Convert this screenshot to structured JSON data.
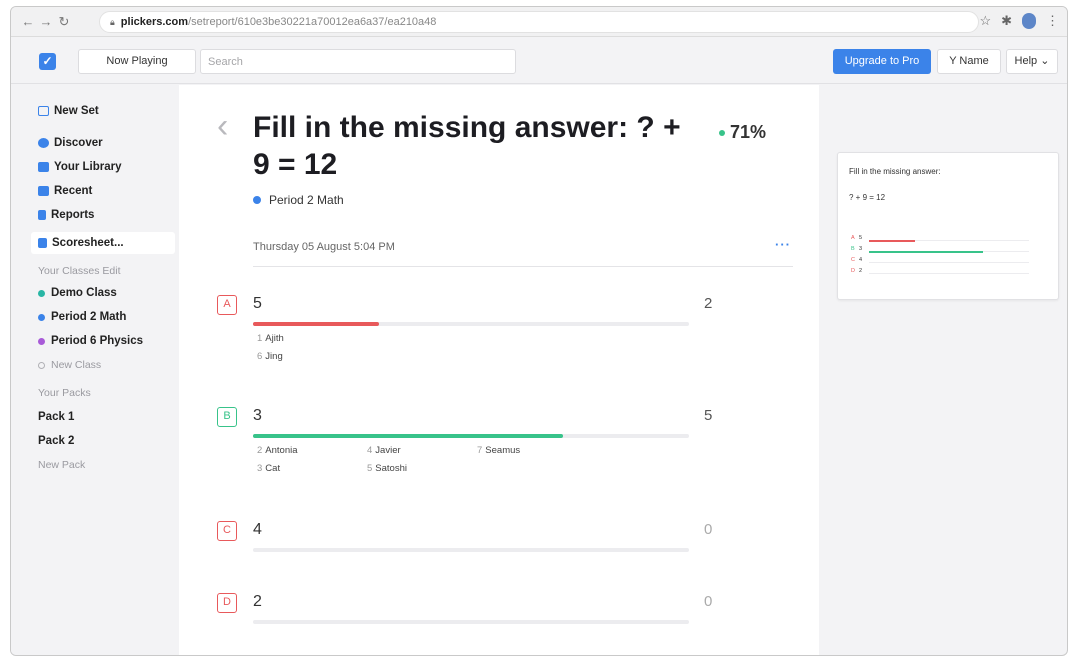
{
  "browser": {
    "url_host": "plickers.com",
    "url_path": "/setreport/610e3be30221a70012ea6a37/ea210a48"
  },
  "topbar": {
    "now_playing": "Now Playing",
    "search_placeholder": "Search",
    "upgrade": "Upgrade to Pro",
    "user": "Y Name",
    "help": "Help ⌄"
  },
  "sidebar": {
    "primary": [
      {
        "label": "New Set",
        "icon": "new-set-icon",
        "color": "#3b83e9"
      },
      {
        "label": "Discover",
        "icon": "discover-icon",
        "color": "#3b83e9"
      },
      {
        "label": "Your Library",
        "icon": "folder-icon",
        "color": "#3b83e9"
      },
      {
        "label": "Recent",
        "icon": "recent-icon",
        "color": "#3b83e9"
      },
      {
        "label": "Reports",
        "icon": "reports-icon",
        "color": "#3b83e9"
      },
      {
        "label": "Scoresheet...",
        "icon": "scoresheet-icon",
        "color": "#3b83e9"
      }
    ],
    "classes_header": "Your Classes  Edit",
    "classes": [
      {
        "label": "Demo Class",
        "color": "#29b6a5"
      },
      {
        "label": "Period 2 Math",
        "color": "#3b83e9"
      },
      {
        "label": "Period 6 Physics",
        "color": "#a85ad8"
      }
    ],
    "new_class": "New Class",
    "packs_header": "Your Packs",
    "packs": [
      "Pack 1",
      "Pack 2"
    ],
    "new_pack": "New Pack"
  },
  "main": {
    "back": "‹",
    "title": "Fill in the missing answer: ? + 9 = 12",
    "percent": "71%",
    "class_name": "Period 2 Math",
    "class_color": "#3b83e9",
    "date": "Thursday 05 August 5:04 PM",
    "more": "···",
    "answers": [
      {
        "letter": "A",
        "value": "5",
        "count": "2",
        "fraction": 0.29,
        "color": "#e8595b",
        "students": [
          {
            "num": "1",
            "name": "Ajith"
          },
          {
            "num": "6",
            "name": "Jing"
          }
        ]
      },
      {
        "letter": "B",
        "value": "3",
        "count": "5",
        "fraction": 0.71,
        "color": "#38c38a",
        "students": [
          {
            "num": "2",
            "name": "Antonia"
          },
          {
            "num": "3",
            "name": "Cat"
          },
          {
            "num": "4",
            "name": "Javier"
          },
          {
            "num": "5",
            "name": "Satoshi"
          },
          {
            "num": "7",
            "name": "Seamus"
          }
        ]
      },
      {
        "letter": "C",
        "value": "4",
        "count": "0",
        "fraction": 0,
        "color": "#e8595b",
        "students": []
      },
      {
        "letter": "D",
        "value": "2",
        "count": "0",
        "fraction": 0,
        "color": "#e8595b",
        "students": []
      }
    ]
  },
  "preview": {
    "question": "Fill in the missing answer:",
    "equation": "? + 9 = 12",
    "rows": [
      {
        "letter": "A",
        "value": "5",
        "color": "#e8595b",
        "fraction": 0.29
      },
      {
        "letter": "B",
        "value": "3",
        "color": "#38c38a",
        "fraction": 0.71
      },
      {
        "letter": "C",
        "value": "4",
        "color": "#e8595b",
        "fraction": 0
      },
      {
        "letter": "D",
        "value": "2",
        "color": "#e8595b",
        "fraction": 0
      }
    ]
  }
}
